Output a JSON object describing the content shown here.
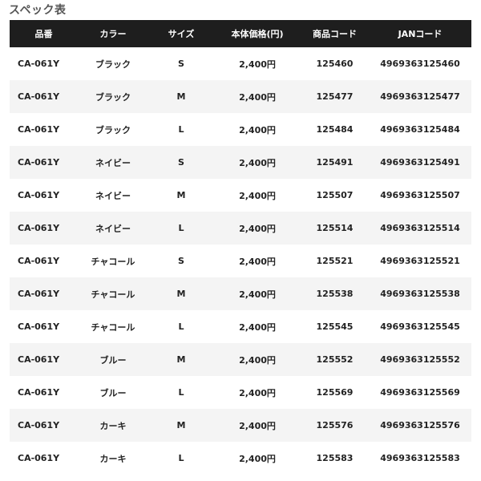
{
  "title": "スペック表",
  "headers": [
    "品番",
    "カラー",
    "サイズ",
    "本体価格(円)",
    "商品コード",
    "JANコード"
  ],
  "rows": [
    [
      "CA-061Y",
      "ブラック",
      "S",
      "2,400円",
      "125460",
      "4969363125460"
    ],
    [
      "CA-061Y",
      "ブラック",
      "M",
      "2,400円",
      "125477",
      "4969363125477"
    ],
    [
      "CA-061Y",
      "ブラック",
      "L",
      "2,400円",
      "125484",
      "4969363125484"
    ],
    [
      "CA-061Y",
      "ネイビー",
      "S",
      "2,400円",
      "125491",
      "4969363125491"
    ],
    [
      "CA-061Y",
      "ネイビー",
      "M",
      "2,400円",
      "125507",
      "4969363125507"
    ],
    [
      "CA-061Y",
      "ネイビー",
      "L",
      "2,400円",
      "125514",
      "4969363125514"
    ],
    [
      "CA-061Y",
      "チャコール",
      "S",
      "2,400円",
      "125521",
      "4969363125521"
    ],
    [
      "CA-061Y",
      "チャコール",
      "M",
      "2,400円",
      "125538",
      "4969363125538"
    ],
    [
      "CA-061Y",
      "チャコール",
      "L",
      "2,400円",
      "125545",
      "4969363125545"
    ],
    [
      "CA-061Y",
      "ブルー",
      "M",
      "2,400円",
      "125552",
      "4969363125552"
    ],
    [
      "CA-061Y",
      "ブルー",
      "L",
      "2,400円",
      "125569",
      "4969363125569"
    ],
    [
      "CA-061Y",
      "カーキ",
      "M",
      "2,400円",
      "125576",
      "4969363125576"
    ],
    [
      "CA-061Y",
      "カーキ",
      "L",
      "2,400円",
      "125583",
      "4969363125583"
    ]
  ]
}
